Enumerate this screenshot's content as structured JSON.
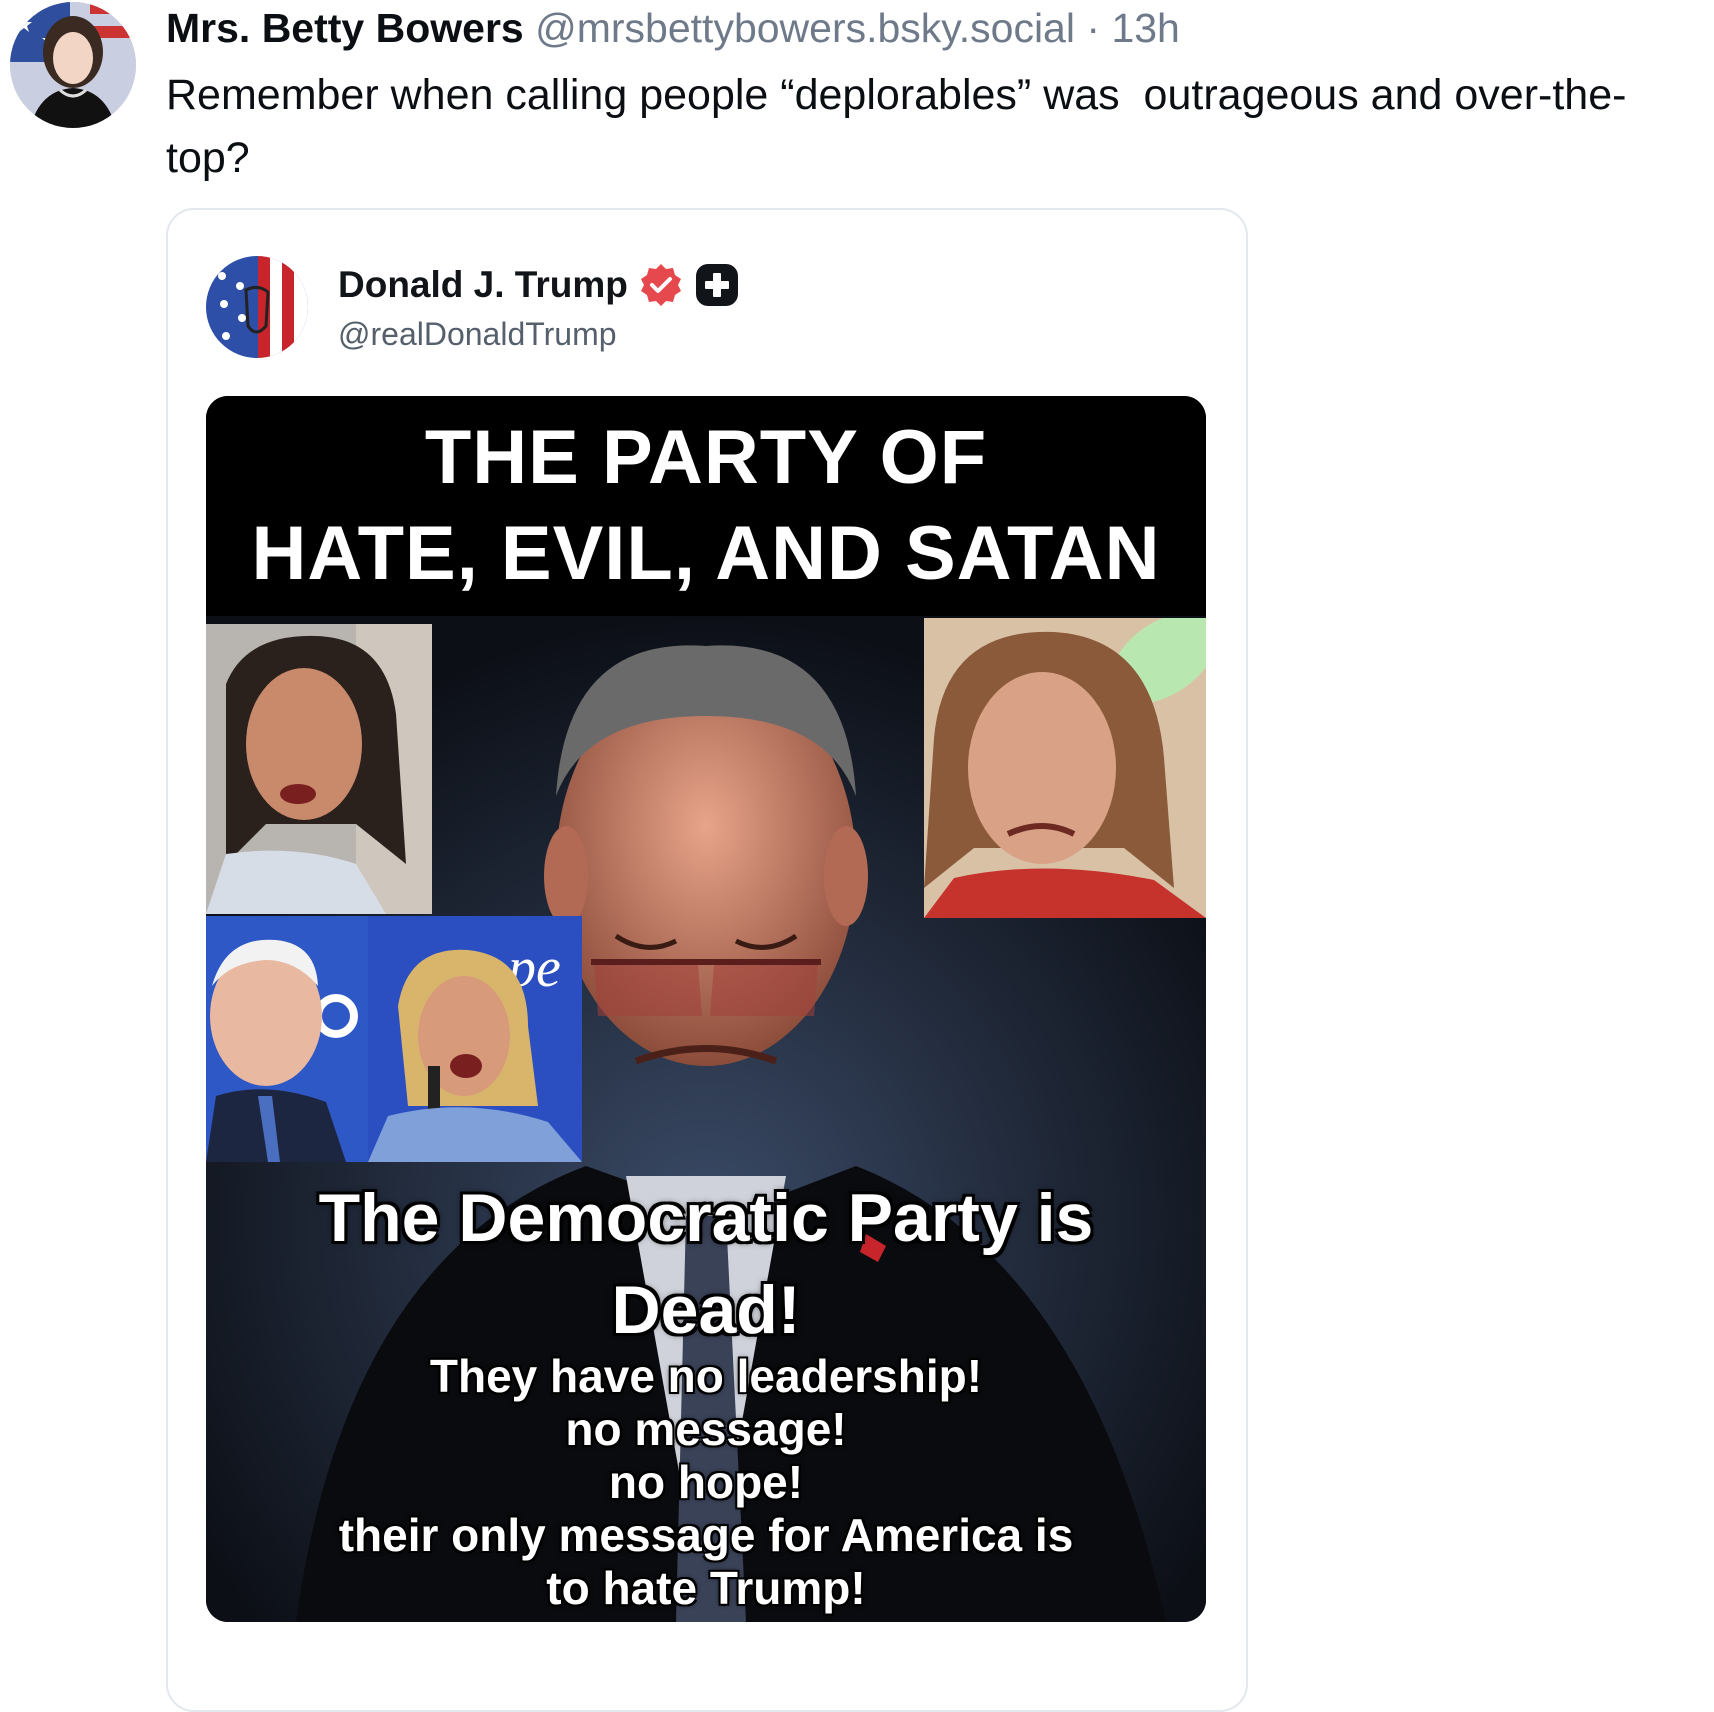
{
  "author": {
    "display_name": "Mrs. Betty Bowers",
    "handle": "@mrsbettybowers.bsky.social",
    "separator": "·",
    "timestamp": "13h"
  },
  "post": {
    "text": "Remember when calling people “deplorables” was  outrageous and over-the-top?"
  },
  "embed": {
    "display_name": "Donald J. Trump",
    "handle": "@realDonaldTrump",
    "meme": {
      "title_line1": "THE PARTY OF",
      "title_line2": "HATE, EVIL, AND SATAN",
      "partial_sign_text": "pe",
      "headline_line1": "The Democratic Party is",
      "headline_line2": "Dead!",
      "sub_line1": "They have no leadership!",
      "sub_line2": "no message!",
      "sub_line3": "no hope!",
      "sub_line4": "their only message for America is",
      "sub_line5": "to hate Trump!"
    }
  },
  "colors": {
    "text_primary": "#0b0f14",
    "text_secondary": "#6e7a8a",
    "card_border": "#e3e8ee",
    "verified_badge": "#e5484d",
    "meme_background": "#000000"
  },
  "icons": {
    "verified": "verified-badge-icon",
    "plus": "plus-badge-icon"
  }
}
